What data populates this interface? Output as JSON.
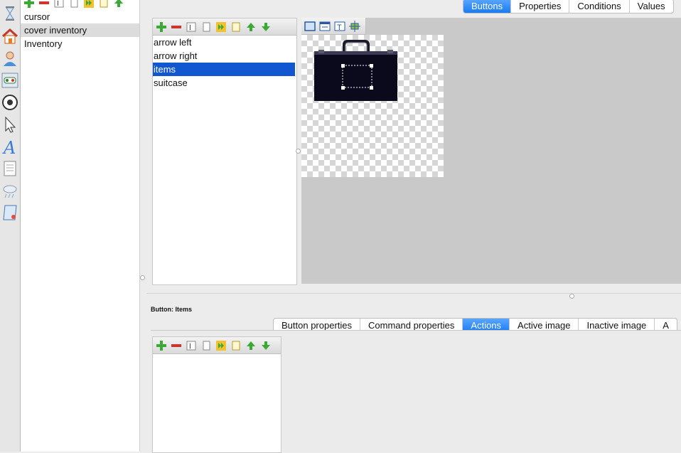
{
  "icons": {
    "side": [
      "hourglass-icon",
      "house-icon",
      "character-icon",
      "gamepad-icon",
      "soccer-ball-icon",
      "cursor-arrow-icon",
      "font-icon",
      "page-icon",
      "weather-icon",
      "script-icon"
    ],
    "toolbar": [
      "add-icon",
      "remove-icon",
      "rename-icon",
      "copy-icon",
      "forward-icon",
      "paste-icon",
      "up-arrow-icon",
      "down-arrow-icon"
    ],
    "editor_toolbar": [
      "select-area-icon",
      "window-icon",
      "text-icon",
      "fit-icon"
    ]
  },
  "left_list": {
    "items": [
      "cursor",
      "cover inventory",
      "Inventory"
    ]
  },
  "top_tabs": [
    "Buttons",
    "Properties",
    "Conditions",
    "Values"
  ],
  "buttons_list": {
    "items": [
      "arrow left",
      "arrow right",
      "items",
      "suitcase"
    ]
  },
  "button_heading": "Button: Items",
  "bottom_tabs": [
    "Button properties",
    "Command properties",
    "Actions",
    "Active image",
    "Inactive image",
    "A"
  ],
  "colors": {
    "accent": "#1b7bf2",
    "selection": "#1158d0",
    "suitcase": "#0a0a1c"
  }
}
